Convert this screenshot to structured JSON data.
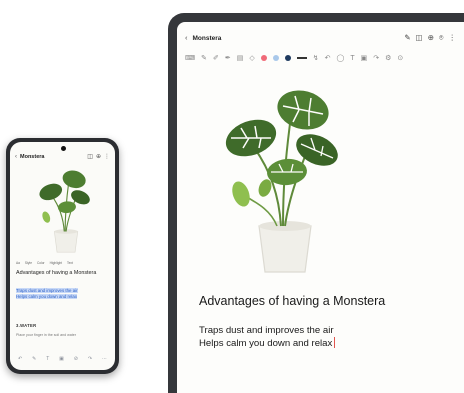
{
  "phone": {
    "title": "Monstera",
    "toolbar": [
      "Aa",
      "Style",
      "Color",
      "Highlight",
      "Text"
    ],
    "heading": "Advantages of having a Monstera",
    "selection_lines": [
      "Traps dust and improves the air",
      "Helps calm you down and relax"
    ],
    "section": "3.WATER",
    "hint": "Place your finger in the soil and water"
  },
  "tablet": {
    "title": "Monstera",
    "heading": "Advantages of having a Monstera",
    "body_lines": [
      "Traps dust and improves the air",
      "Helps calm you down and relax"
    ]
  },
  "colors": {
    "accent_blue": "#2f63c7",
    "pen_pink": "#f06a78",
    "pen_light_blue": "#a9c8ea",
    "pen_navy": "#1f3a5f",
    "cursor_red": "#e0564f"
  },
  "icons": {
    "back": "chevron-left-icon",
    "edit": "pen-icon",
    "read": "book-icon",
    "share": "share-icon",
    "more": "more-vertical-icon"
  }
}
